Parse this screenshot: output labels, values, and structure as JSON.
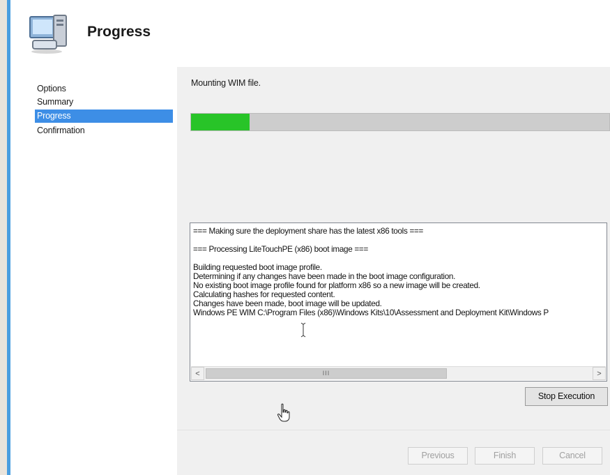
{
  "window": {
    "title": "Progress",
    "accent_color": "#4a9ee0",
    "icon": "computer-icon"
  },
  "nav": {
    "items": [
      {
        "label": "Options",
        "active": false
      },
      {
        "label": "Summary",
        "active": false
      },
      {
        "label": "Progress",
        "active": true
      },
      {
        "label": "Confirmation",
        "active": false
      }
    ],
    "active_color": "#3d8ee6"
  },
  "main": {
    "status": "Mounting WIM file.",
    "progress": {
      "fraction": 0.14,
      "fill_color": "#28c428"
    },
    "log_lines": [
      "=== Making sure the deployment share has the latest x86 tools ===",
      "",
      "=== Processing LiteTouchPE (x86) boot image ===",
      "",
      "Building requested boot image profile.",
      "Determining if any changes have been made in the boot image configuration.",
      "No existing boot image profile found for platform x86 so a new image will be created.",
      "Calculating hashes for requested content.",
      "Changes have been made, boot image will be updated.",
      "Windows PE WIM C:\\Program Files (x86)\\Windows Kits\\10\\Assessment and Deployment Kit\\Windows P"
    ],
    "scrollbar_grip": "III",
    "stop_button": "Stop Execution"
  },
  "footer": {
    "previous": "Previous",
    "finish": "Finish",
    "cancel": "Cancel"
  }
}
